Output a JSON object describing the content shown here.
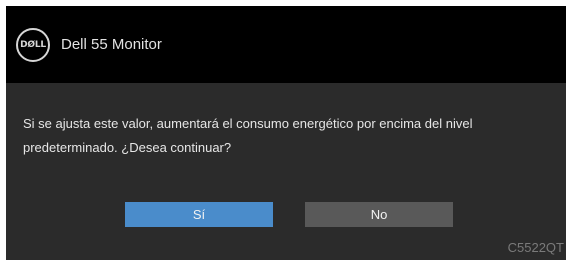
{
  "brand": {
    "logo_text": "DØLL",
    "logo_icon": "dell-logo-icon"
  },
  "header": {
    "title": "Dell 55 Monitor"
  },
  "dialog": {
    "message_line_1": "Si se ajusta este valor, aumentará el consumo energético por encima del nivel",
    "message_line_2": "predeterminado. ¿Desea continuar?",
    "yes_label": "Sí",
    "no_label": "No"
  },
  "footer": {
    "model": "C5522QT"
  },
  "colors": {
    "osd_background": "#2b2b2b",
    "header_background": "#000000",
    "yes_button": "#4a8ccb",
    "no_button": "#595959",
    "model_text": "#7a7a7a"
  }
}
